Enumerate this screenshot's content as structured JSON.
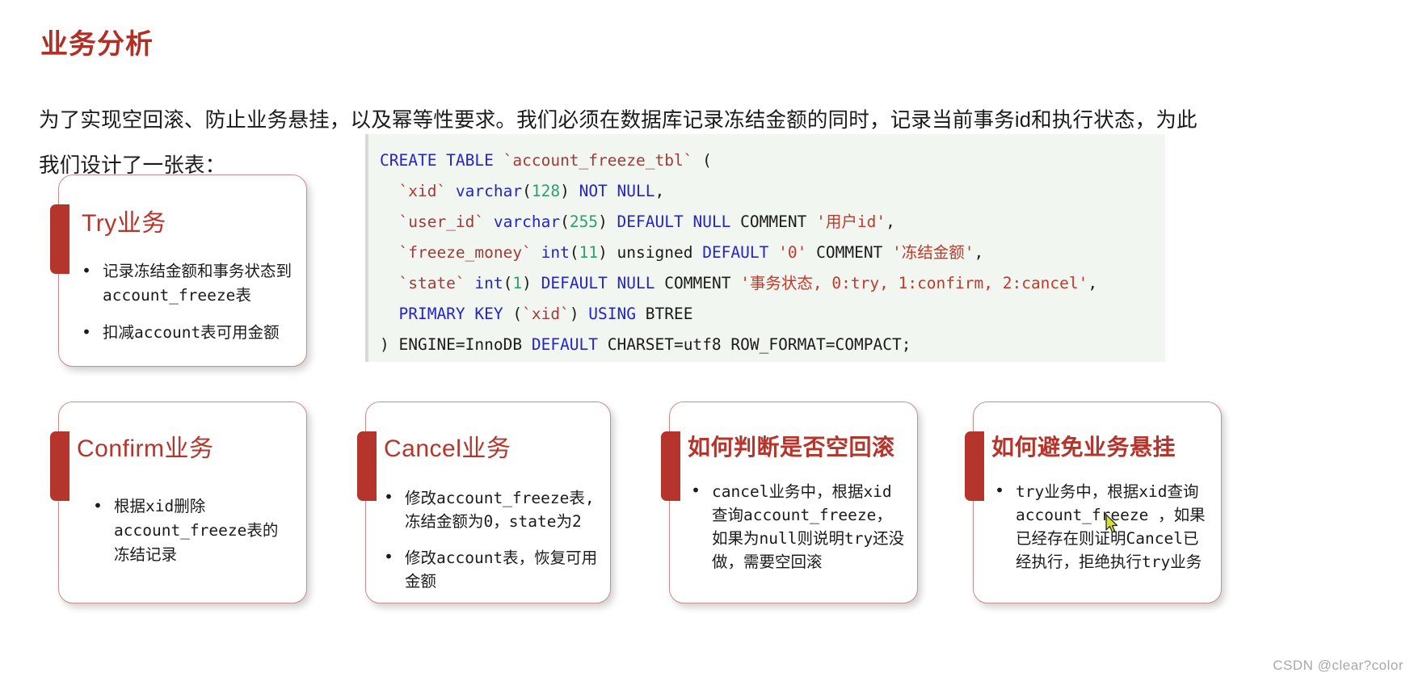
{
  "page": {
    "title": "业务分析",
    "intro": "为了实现空回滚、防止业务悬挂，以及幂等性要求。我们必须在数据库记录冻结金额的同时，记录当前事务id和执行状态，为此我们设计了一张表："
  },
  "sql": {
    "language": "sql",
    "lines": [
      [
        {
          "t": "CREATE TABLE ",
          "c": "k"
        },
        {
          "t": "`account_freeze_tbl`",
          "c": "id"
        },
        {
          "t": " (",
          "c": "pl"
        }
      ],
      [
        {
          "t": "  ",
          "c": "pl"
        },
        {
          "t": "`xid`",
          "c": "id"
        },
        {
          "t": " varchar",
          "c": "k"
        },
        {
          "t": "(",
          "c": "pl"
        },
        {
          "t": "128",
          "c": "num"
        },
        {
          "t": ") ",
          "c": "pl"
        },
        {
          "t": "NOT NULL",
          "c": "k"
        },
        {
          "t": ",",
          "c": "pl"
        }
      ],
      [
        {
          "t": "  ",
          "c": "pl"
        },
        {
          "t": "`user_id`",
          "c": "id"
        },
        {
          "t": " varchar",
          "c": "k"
        },
        {
          "t": "(",
          "c": "pl"
        },
        {
          "t": "255",
          "c": "num"
        },
        {
          "t": ") ",
          "c": "pl"
        },
        {
          "t": "DEFAULT NULL",
          "c": "k"
        },
        {
          "t": " COMMENT ",
          "c": "pl"
        },
        {
          "t": "'用户id'",
          "c": "str"
        },
        {
          "t": ",",
          "c": "pl"
        }
      ],
      [
        {
          "t": "  ",
          "c": "pl"
        },
        {
          "t": "`freeze_money`",
          "c": "id"
        },
        {
          "t": " int",
          "c": "k"
        },
        {
          "t": "(",
          "c": "pl"
        },
        {
          "t": "11",
          "c": "num"
        },
        {
          "t": ") unsigned ",
          "c": "pl"
        },
        {
          "t": "DEFAULT",
          "c": "k"
        },
        {
          "t": " ",
          "c": "pl"
        },
        {
          "t": "'0'",
          "c": "str"
        },
        {
          "t": " COMMENT ",
          "c": "pl"
        },
        {
          "t": "'冻结金额'",
          "c": "str"
        },
        {
          "t": ",",
          "c": "pl"
        }
      ],
      [
        {
          "t": "  ",
          "c": "pl"
        },
        {
          "t": "`state`",
          "c": "id"
        },
        {
          "t": " int",
          "c": "k"
        },
        {
          "t": "(",
          "c": "pl"
        },
        {
          "t": "1",
          "c": "num"
        },
        {
          "t": ") ",
          "c": "pl"
        },
        {
          "t": "DEFAULT NULL",
          "c": "k"
        },
        {
          "t": " COMMENT ",
          "c": "pl"
        },
        {
          "t": "'事务状态, 0:try, 1:confirm, 2:cancel'",
          "c": "str"
        },
        {
          "t": ",",
          "c": "pl"
        }
      ],
      [
        {
          "t": "  ",
          "c": "pl"
        },
        {
          "t": "PRIMARY KEY",
          "c": "k"
        },
        {
          "t": " (",
          "c": "pl"
        },
        {
          "t": "`xid`",
          "c": "id"
        },
        {
          "t": ") ",
          "c": "pl"
        },
        {
          "t": "USING",
          "c": "k"
        },
        {
          "t": " BTREE",
          "c": "pl"
        }
      ],
      [
        {
          "t": ") ENGINE=InnoDB ",
          "c": "pl"
        },
        {
          "t": "DEFAULT",
          "c": "k"
        },
        {
          "t": " CHARSET=utf8 ROW_FORMAT=COMPACT;",
          "c": "pl"
        }
      ]
    ]
  },
  "cards": [
    {
      "id": "try",
      "title": "Try业务",
      "bullets": [
        "记录冻结金额和事务状态到\naccount_freeze表",
        "扣减account表可用金额"
      ]
    },
    {
      "id": "confirm",
      "title": "Confirm业务",
      "bullets": [
        "根据xid删除\naccount_freeze表的\n冻结记录"
      ]
    },
    {
      "id": "cancel",
      "title": "Cancel业务",
      "bullets": [
        "修改account_freeze表,\n冻结金额为0，state为2",
        "修改account表，恢复可用\n金额"
      ]
    },
    {
      "id": "empty-rollback",
      "title": "如何判断是否空回滚",
      "bullets": [
        "cancel业务中，根据xid\n查询account_freeze，\n如果为null则说明try还没\n做，需要空回滚"
      ]
    },
    {
      "id": "hanging",
      "title": "如何避免业务悬挂",
      "bullets": [
        "try业务中，根据xid查询\naccount_freeze ，如果\n已经存在则证明Cancel已\n经执行，拒绝执行try业务"
      ]
    }
  ],
  "watermark": "CSDN @clear?color",
  "colors": {
    "accent_red": "#b5342b",
    "title_red": "#b03028",
    "card_border": "#c98c8c",
    "code_bg": "#f2f6f0",
    "keyword": "#2424c8",
    "identifier": "#a33a3a",
    "number": "#2f9e6e",
    "string": "#c0392b"
  }
}
